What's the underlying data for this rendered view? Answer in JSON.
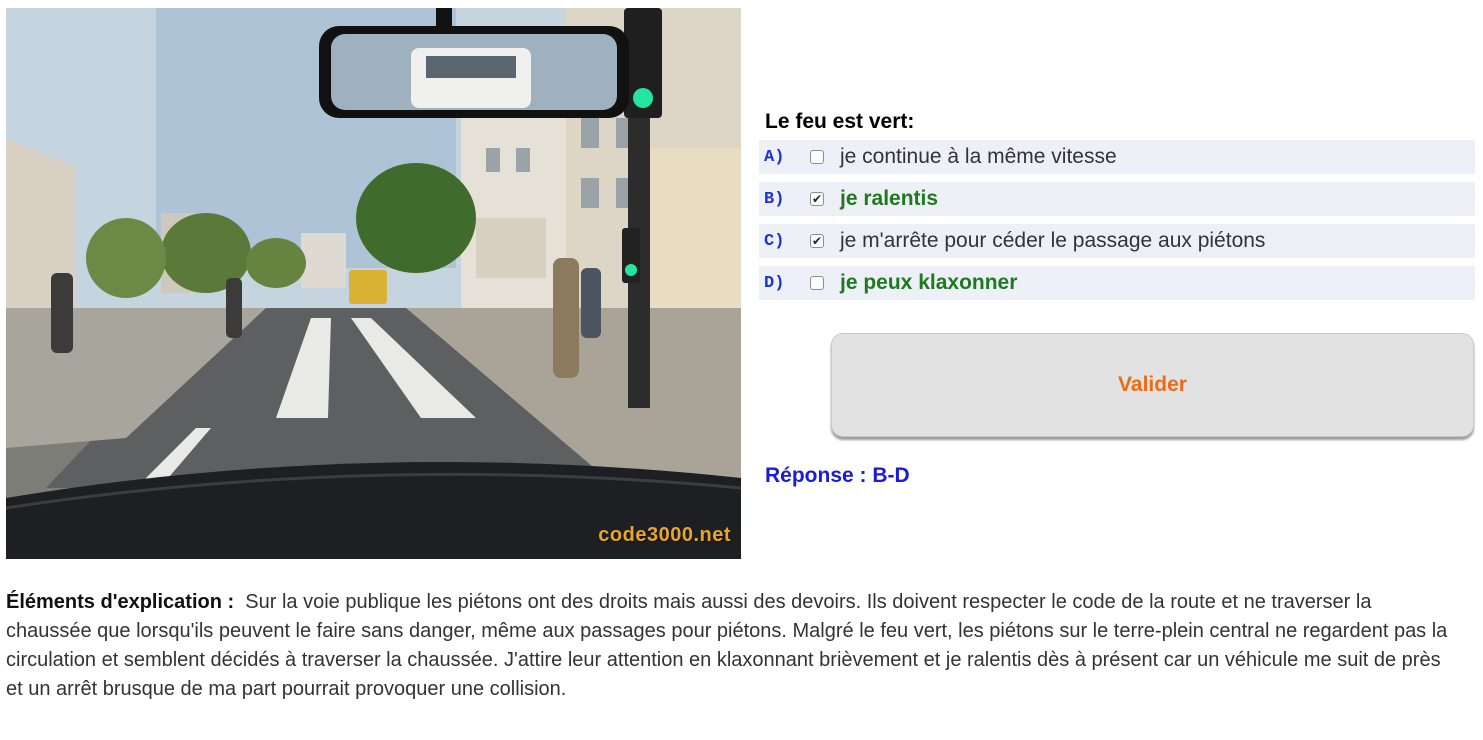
{
  "photo": {
    "watermark": "code3000.net"
  },
  "question": {
    "title": "Le feu est vert:",
    "answers": [
      {
        "letter": "A)",
        "text": "je continue à la même vitesse",
        "checked": false,
        "correct": false
      },
      {
        "letter": "B)",
        "text": "je ralentis",
        "checked": true,
        "correct": true
      },
      {
        "letter": "C)",
        "text": "je m'arrête pour céder le passage aux piétons",
        "checked": true,
        "correct": false
      },
      {
        "letter": "D)",
        "text": "je peux klaxonner",
        "checked": false,
        "correct": true
      }
    ],
    "validate_label": "Valider",
    "response": "Réponse : B-D"
  },
  "explanation": {
    "heading": "Éléments d'explication :",
    "text": "Sur la voie publique les piétons ont des droits mais aussi des devoirs. Ils doivent respecter le code de la route et ne traverser la chaussée que lorsqu'ils peuvent le faire sans danger, même aux passages pour piétons. Malgré le feu vert, les piétons sur le terre-plein central ne regardent pas la circulation et semblent décidés à traverser la chaussée. J'attire leur attention en klaxonnant brièvement et je ralentis dès à présent car un véhicule me suit de près et un arrêt brusque de ma part pourrait provoquer une collision."
  },
  "colors": {
    "letter": "#1b34d6",
    "correct_text": "#1f7a1f",
    "validate_text": "#ef6a14",
    "response": "#1b1bdc",
    "row_background": "#eef0f7"
  }
}
